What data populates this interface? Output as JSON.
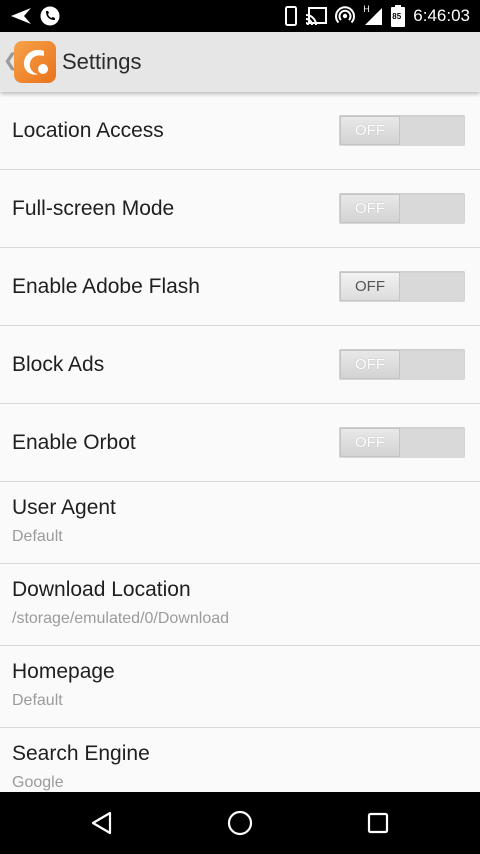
{
  "status_bar": {
    "time": "6:46:03",
    "left_icons": [
      "navigation-arrow-icon",
      "phone-icon"
    ],
    "right_icons": [
      "phone-outline-icon",
      "cast-icon",
      "hotspot-icon",
      "signal-icon",
      "battery-icon"
    ],
    "signal_label": "H",
    "battery_label": "85"
  },
  "action_bar": {
    "title": "Settings",
    "logo_icon": "app-logo-icon",
    "back_icon": "chevron-left-icon",
    "back_glyph": "❮",
    "logo_color": "#f28b2c"
  },
  "settings": {
    "toggles": [
      {
        "label": "Location Access",
        "state": "OFF"
      },
      {
        "label": "Full-screen Mode",
        "state": "OFF"
      },
      {
        "label": "Enable Adobe Flash",
        "state": "OFF"
      },
      {
        "label": "Block Ads",
        "state": "OFF"
      },
      {
        "label": "Enable Orbot",
        "state": "OFF"
      }
    ],
    "items": [
      {
        "label": "User Agent",
        "value": "Default"
      },
      {
        "label": "Download Location",
        "value": "/storage/emulated/0/Download"
      },
      {
        "label": "Homepage",
        "value": "Default"
      },
      {
        "label": "Search Engine",
        "value": "Google"
      }
    ]
  },
  "nav_bar": {
    "icons": [
      "back-triangle-icon",
      "home-circle-icon",
      "recents-square-icon"
    ]
  }
}
